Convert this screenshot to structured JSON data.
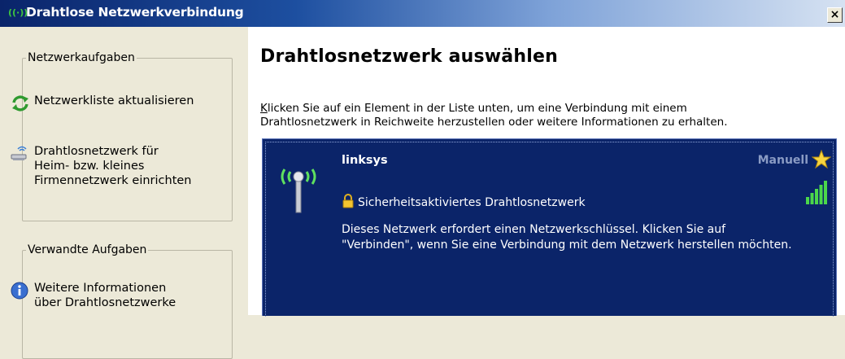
{
  "window": {
    "title": "Drahtlose Netzwerkverbindung",
    "close_label": "×"
  },
  "sidebar": {
    "network_tasks": {
      "legend": "Netzwerkaufgaben",
      "items": [
        {
          "label": "Netzwerkliste aktualisieren",
          "icon": "refresh-icon"
        },
        {
          "lines": [
            "Drahtlosnetzwerk für",
            "Heim- bzw. kleines",
            "Firmennetzwerk einrichten"
          ],
          "icon": "wireless-setup-icon"
        }
      ]
    },
    "related_tasks": {
      "legend": "Verwandte Aufgaben",
      "items": [
        {
          "lines": [
            "Weitere Informationen",
            "über Drahtlosnetzwerke"
          ],
          "icon": "info-icon"
        }
      ]
    }
  },
  "main": {
    "heading": "Drahtlosnetzwerk auswählen",
    "instructions": {
      "accesskey": "K",
      "line1_rest": "licken Sie auf ein Element in der Liste unten, um eine Verbindung mit einem",
      "line2": "Drahtlosnetzwerk in Reichweite herzustellen oder weitere Informationen zu erhalten."
    },
    "networks": [
      {
        "ssid": "linksys",
        "mode": "Manuell",
        "security": "Sicherheitsaktiviertes Drahtlosnetzwerk",
        "description_line1": "Dieses Netzwerk erfordert einen Netzwerkschlüssel. Klicken Sie auf",
        "description_line2": "\"Verbinden\", wenn Sie eine Verbindung mit dem Netzwerk herstellen möchten.",
        "signal_level": 1.0
      }
    ]
  },
  "colors": {
    "title_gradient_start": "#0a246a",
    "list_background": "#0b2469",
    "window_background": "#ece9d8",
    "signal_green": "#4bd74b"
  }
}
